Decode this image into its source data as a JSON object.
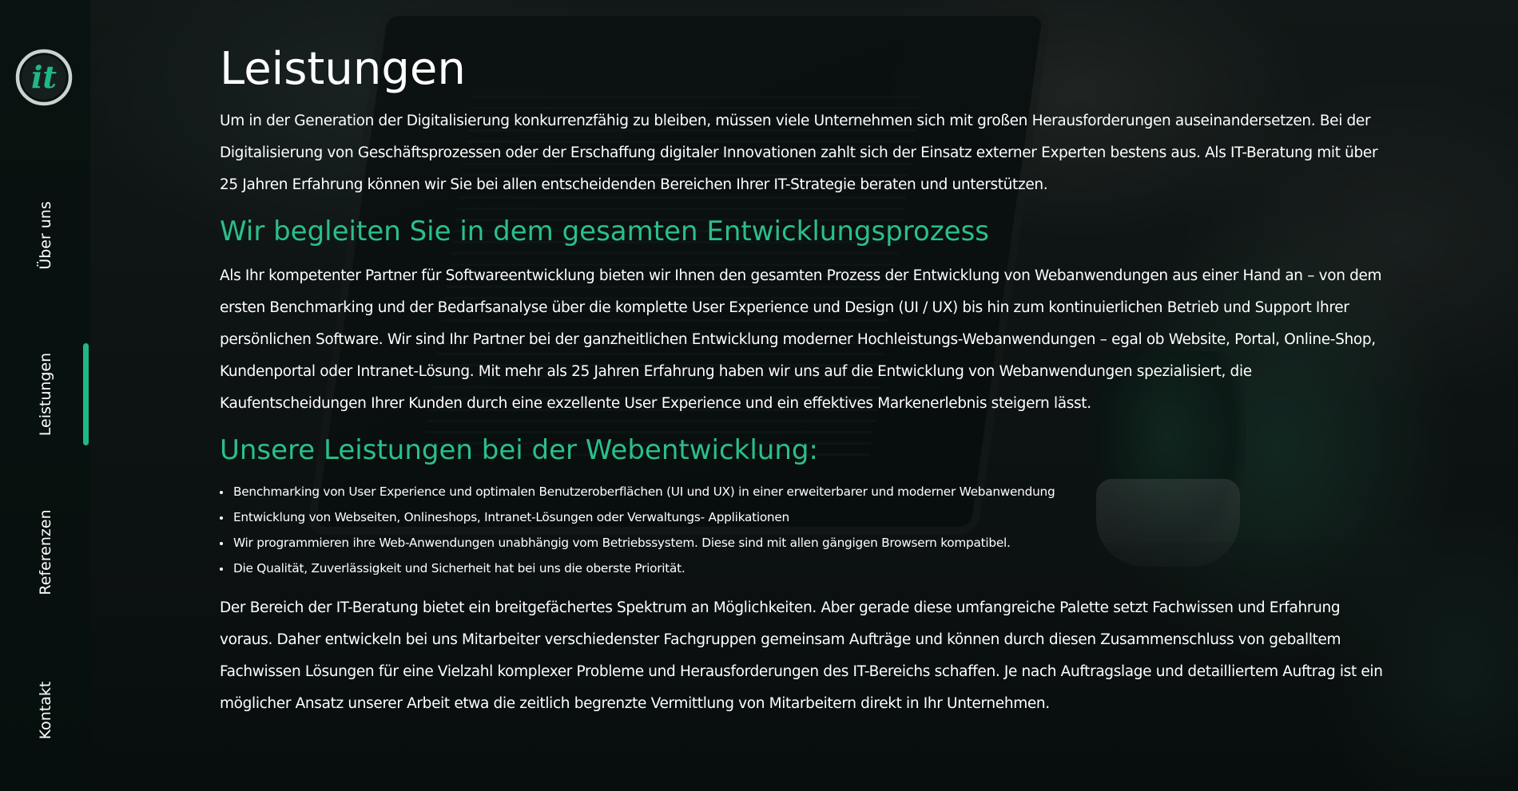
{
  "brand": {
    "logo_text": "it",
    "accent_color": "#1fb888"
  },
  "nav": {
    "items": [
      {
        "label": "Über uns",
        "active": false
      },
      {
        "label": "Leistungen",
        "active": true
      },
      {
        "label": "Referenzen",
        "active": false
      },
      {
        "label": "Kontakt",
        "active": false
      }
    ]
  },
  "main": {
    "title": "Leistungen",
    "intro": "Um in der Generation der Digitalisierung konkurrenzfähig zu bleiben, müssen viele Unternehmen sich mit großen Herausforderungen auseinandersetzen. Bei der Digitalisierung von Geschäftsprozessen oder der Erschaffung digitaler Innovationen zahlt sich der Einsatz externer Experten bestens aus. Als IT-Beratung mit über 25 Jahren Erfahrung können wir Sie bei allen entscheidenden Bereichen Ihrer IT-Strategie beraten und unterstützen.",
    "section1_heading": "Wir begleiten Sie in dem gesamten Entwicklungsprozess",
    "section1_text": "Als Ihr kompetenter Partner für Softwareentwicklung bieten wir Ihnen den gesamten Prozess der Entwicklung von Webanwendungen aus einer Hand an – von dem ersten Benchmarking und der Bedarfsanalyse über die komplette User Experience und Design (UI / UX) bis hin zum kontinuierlichen Betrieb und Support Ihrer persönlichen Software. Wir sind Ihr Partner bei der ganzheitlichen Entwicklung moderner Hochleistungs-Webanwendungen – egal ob Website, Portal, Online-Shop, Kundenportal oder Intranet-Lösung. Mit mehr als 25 Jahren Erfahrung haben wir uns auf die Entwicklung von Webanwendungen spezialisiert, die Kaufentscheidungen Ihrer Kunden durch eine exzellente User Experience und ein effektives Markenerlebnis steigern lässt.",
    "section2_heading": "Unsere Leistungen bei der Webentwicklung:",
    "services": [
      "Benchmarking von User Experience und optimalen Benutzeroberflächen (UI und UX) in einer erweiterbarer und moderner Webanwendung",
      "Entwicklung von Webseiten, Onlineshops, Intranet-Lösungen oder Verwaltungs- Applikationen",
      "Wir programmieren ihre Web-Anwendungen unabhängig vom Betriebssystem. Diese sind mit allen gängigen Browsern kompatibel.",
      "Die Qualität, Zuverlässigkeit und Sicherheit hat bei uns die oberste Priorität."
    ],
    "closing": "Der Bereich der IT-Beratung bietet ein breitgefächertes Spektrum an Möglichkeiten. Aber gerade diese umfangreiche Palette setzt Fachwissen und Erfahrung voraus. Daher entwickeln bei uns Mitarbeiter verschiedenster Fachgruppen gemeinsam Aufträge und können durch diesen Zusammenschluss von geballtem Fachwissen Lösungen für eine Vielzahl komplexer Probleme und Herausforderungen des IT-Bereichs schaffen. Je nach Auftragslage und detailliertem Auftrag ist ein möglicher Ansatz unserer Arbeit etwa die zeitlich begrenzte Vermittlung von Mitarbeitern direkt in Ihr Unternehmen."
  }
}
